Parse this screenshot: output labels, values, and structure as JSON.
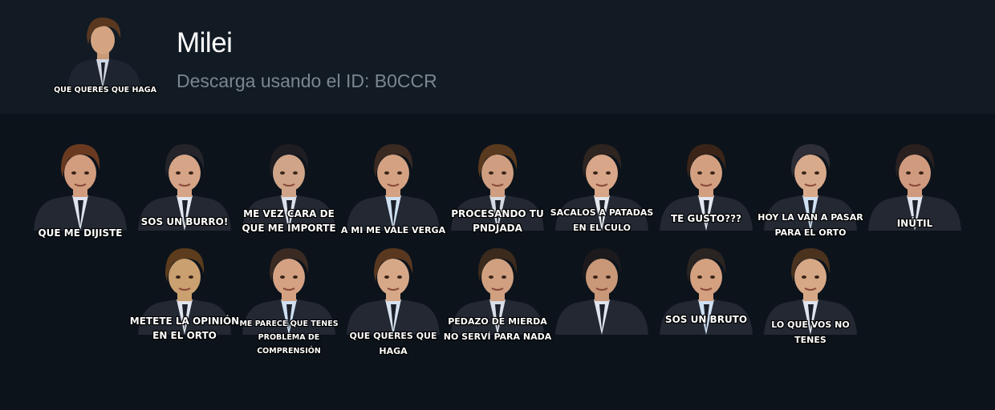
{
  "header": {
    "title": "Milei",
    "subtitle": "Descarga usando el ID: B0CCR",
    "thumb_caption": "QUE QUERES QUE  HAGA"
  },
  "stickers": [
    {
      "caption": "QUE ME DIJISTE",
      "hair": "#6a3a20"
    },
    {
      "caption": "SOS UN BURRO!",
      "hair": "#24242a"
    },
    {
      "caption": "ME VEZ CARA DE\nQUE ME IMPORTE",
      "hair": "#1d1d22"
    },
    {
      "caption": "A MI ME VALE  VERGA",
      "hair": "#3a2a22"
    },
    {
      "caption": "PROCESANDO TU\nPNDJADA",
      "hair": "#5a3a1e"
    },
    {
      "caption": "SACALOS A  PATADAS\nEN EL CULO",
      "hair": "#2e2420"
    },
    {
      "caption": "TE GUSTO???",
      "hair": "#3a2418"
    },
    {
      "caption": "HOY LA VAN A PASAR\nPARA EL ORTO",
      "hair": "#2e2e36"
    },
    {
      "caption": "INÚTIL",
      "hair": "#2a2020"
    },
    {
      "caption": "METETE LA OPINIÓN\nEN EL ORTO",
      "hair": "#5c3c1c"
    },
    {
      "caption": "ME PARECE QUE TENES\nPROBLEMA DE COMPRENSIÓN",
      "hair": "#3a2a22"
    },
    {
      "caption": "QUE QUERES QUE  HAGA",
      "hair": "#5a3820"
    },
    {
      "caption": "PEDAZO DE  MIERDA\nNO SERVÍ PARA NADA",
      "hair": "#3c2a1c"
    },
    {
      "caption": "",
      "hair": "#1c1a1c"
    },
    {
      "caption": "SOS UN BRUTO",
      "hair": "#2a2422"
    },
    {
      "caption": "LO QUE VOS NO TENES",
      "hair": "#4a321e"
    }
  ]
}
